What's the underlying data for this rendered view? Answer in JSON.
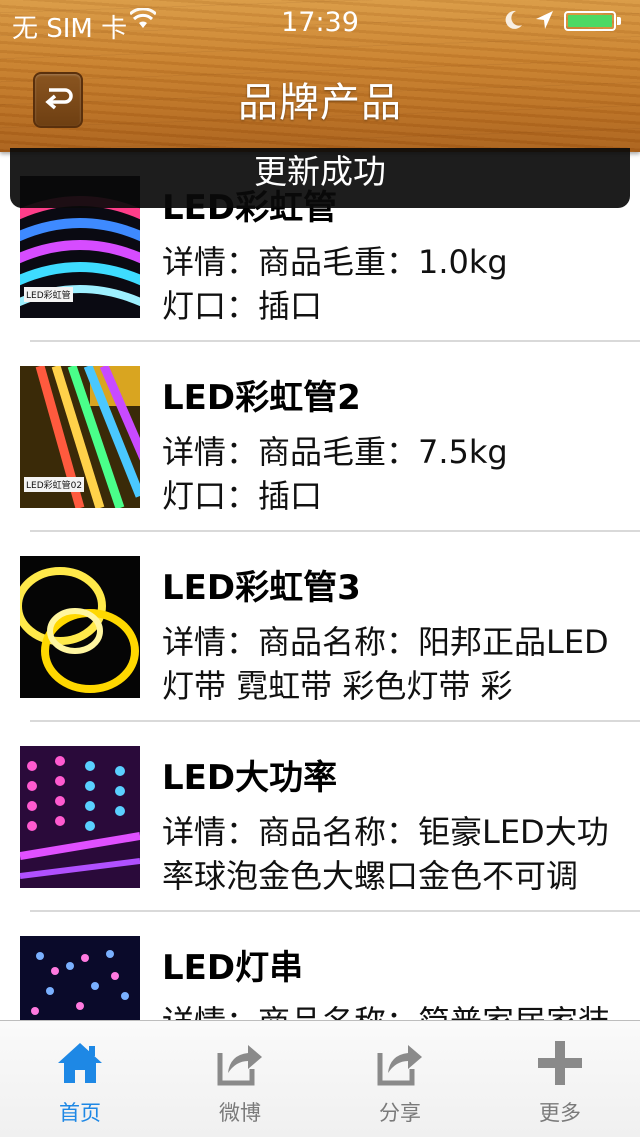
{
  "status_bar": {
    "carrier": "无 SIM 卡",
    "time": "17:39"
  },
  "nav": {
    "title": "品牌产品"
  },
  "toast": {
    "text": "更新成功"
  },
  "products": [
    {
      "name": "LED彩虹管",
      "line1": "详情：商品毛重：1.0kg",
      "line2": "灯口：插口",
      "thumb_label": "LED彩虹管"
    },
    {
      "name": "LED彩虹管2",
      "line1": "详情：商品毛重：7.5kg",
      "line2": "灯口：插口",
      "thumb_label": "LED彩虹管02"
    },
    {
      "name": "LED彩虹管3",
      "line1": "详情：商品名称：阳邦正品LED",
      "line2": "灯带 霓虹带 彩色灯带 彩",
      "thumb_label": ""
    },
    {
      "name": "LED大功率",
      "line1": "详情：商品名称：钜豪LED大功",
      "line2": "率球泡金色大螺口金色不可调",
      "thumb_label": ""
    },
    {
      "name": "LED灯串",
      "line1": "详情：商品名称：简普家居家装",
      "line2": "",
      "thumb_label": ""
    }
  ],
  "tabs": [
    {
      "label": "首页",
      "icon": "home-icon",
      "active": true
    },
    {
      "label": "微博",
      "icon": "share-icon",
      "active": false
    },
    {
      "label": "分享",
      "icon": "share-icon",
      "active": false
    },
    {
      "label": "更多",
      "icon": "plus-icon",
      "active": false
    }
  ],
  "colors": {
    "accent": "#1e88e5",
    "wood": "#c9812e",
    "battery": "#4cd964"
  }
}
